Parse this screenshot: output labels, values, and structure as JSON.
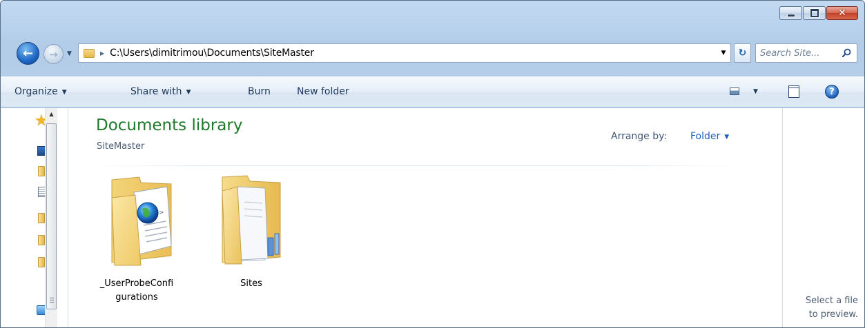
{
  "window": {
    "caption_buttons": {
      "minimize": "minimize",
      "maximize": "maximize",
      "close": "✕"
    }
  },
  "navigation": {
    "back_glyph": "←",
    "forward_glyph": "→",
    "address_path": "C:\\Users\\dimitrimou\\Documents\\SiteMaster",
    "search_placeholder": "Search Site..."
  },
  "command_bar": {
    "organize": "Organize",
    "share_with": "Share with",
    "burn": "Burn",
    "new_folder": "New folder"
  },
  "library": {
    "title": "Documents library",
    "subtitle": "SiteMaster",
    "arrange_label": "Arrange by:",
    "arrange_value": "Folder"
  },
  "items": [
    {
      "name_line1": "_UserProbeConfi",
      "name_line2": "gurations",
      "icon": "folder-with-web-document-icon"
    },
    {
      "name_line1": "Sites",
      "name_line2": "",
      "icon": "folder-with-documents-icon"
    }
  ],
  "preview": {
    "line1": "Select a file",
    "line2": "to preview."
  },
  "colors": {
    "title_green": "#1e7a2a",
    "link_blue": "#1f5fb8",
    "chrome_blue": "#c2d9f2"
  }
}
